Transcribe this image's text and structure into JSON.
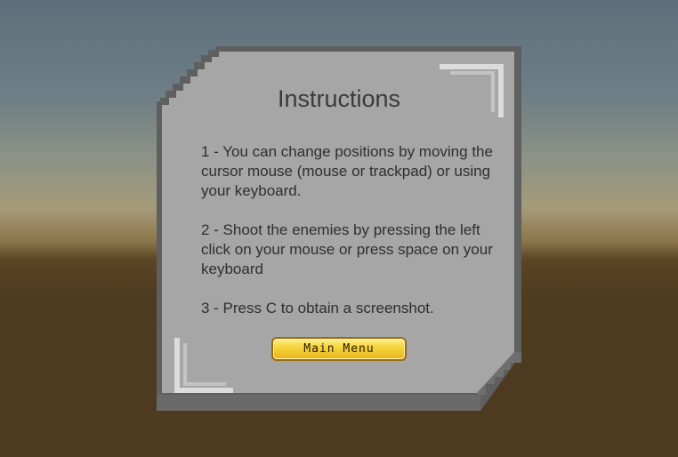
{
  "panel": {
    "title": "Instructions",
    "instructions": [
      "1 - You can change positions by moving the cursor mouse (mouse or trackpad) or using your keyboard.",
      "2 - Shoot the enemies by pressing the left click on your mouse or press space on your keyboard",
      "3 - Press C to obtain a screenshot."
    ],
    "main_menu_label": "Main Menu"
  },
  "colors": {
    "panel_fill": "#a6a6a6",
    "panel_border": "#5f5f5f",
    "button_fill": "#f6d23a",
    "button_border": "#9a6a10"
  }
}
